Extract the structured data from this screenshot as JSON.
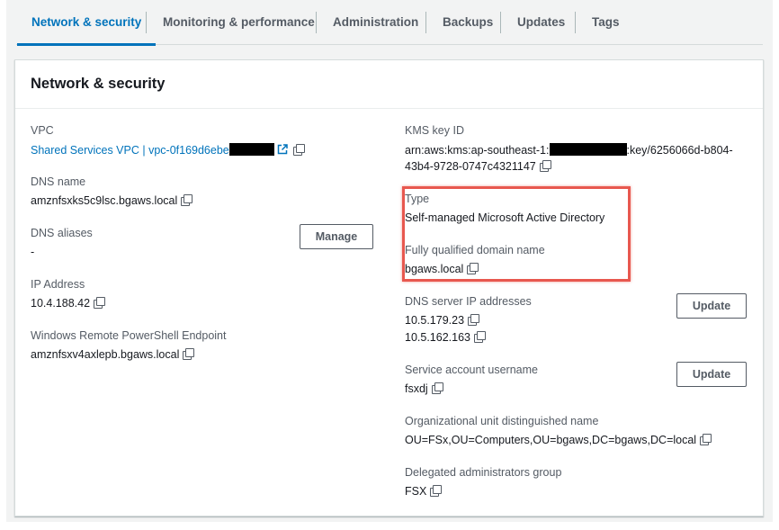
{
  "tabs": [
    {
      "label": "Network & security",
      "active": true
    },
    {
      "label": "Monitoring & performance",
      "active": false
    },
    {
      "label": "Administration",
      "active": false
    },
    {
      "label": "Backups",
      "active": false
    },
    {
      "label": "Updates",
      "active": false
    },
    {
      "label": "Tags",
      "active": false
    }
  ],
  "panel": {
    "title": "Network & security",
    "left": {
      "vpc": {
        "label": "VPC",
        "value": "Shared Services VPC | vpc-0f169d6ebe"
      },
      "dns_name": {
        "label": "DNS name",
        "value": "amznfsxks5c9lsc.bgaws.local"
      },
      "dns_aliases": {
        "label": "DNS aliases",
        "value": "-",
        "button": "Manage"
      },
      "ip_address": {
        "label": "IP Address",
        "value": "10.4.188.42"
      },
      "ps_endpoint": {
        "label": "Windows Remote PowerShell Endpoint",
        "value": "amznfsxv4axlepb.bgaws.local"
      }
    },
    "right": {
      "kms": {
        "label": "KMS key ID",
        "value_prefix": "arn:aws:kms:ap-southeast-1:",
        "value_suffix": ":key/6256066d-b804-",
        "value_line2": "43b4-9728-0747c4321147"
      },
      "type": {
        "label": "Type",
        "value": "Self-managed Microsoft Active Directory"
      },
      "fqdn": {
        "label": "Fully qualified domain name",
        "value": "bgaws.local"
      },
      "dns_servers": {
        "label": "DNS server IP addresses",
        "values": [
          "10.5.179.23",
          "10.5.162.163"
        ],
        "button": "Update"
      },
      "service_account": {
        "label": "Service account username",
        "value": "fsxdj",
        "button": "Update"
      },
      "ou": {
        "label": "Organizational unit distinguished name",
        "value": "OU=FSx,OU=Computers,OU=bgaws,DC=bgaws,DC=local"
      },
      "admins_group": {
        "label": "Delegated administrators group",
        "value": "FSX"
      }
    }
  },
  "colors": {
    "accent": "#0073bb",
    "highlight": "#e8584f",
    "text": "#16191f",
    "label": "#545b64"
  },
  "icons": {
    "copy": "copy-icon",
    "external": "external-link-icon"
  }
}
